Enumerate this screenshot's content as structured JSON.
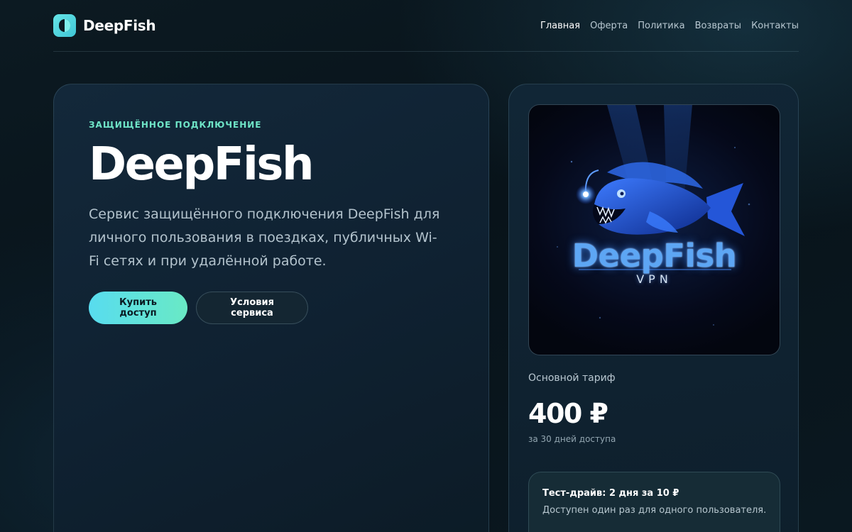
{
  "header": {
    "brand_name": "DeepFish",
    "nav": [
      {
        "label": "Главная",
        "active": true
      },
      {
        "label": "Оферта",
        "active": false
      },
      {
        "label": "Политика",
        "active": false
      },
      {
        "label": "Возвраты",
        "active": false
      },
      {
        "label": "Контакты",
        "active": false
      }
    ]
  },
  "hero": {
    "eyebrow": "Защищённое подключение",
    "title": "DeepFish",
    "description": "Сервис защищённого подключения DeepFish для личного пользования в поездках, публичных Wi-Fi сетях и при удалённой работе.",
    "buy_label": "Купить доступ",
    "terms_label": "Условия сервиса"
  },
  "product": {
    "logo_word": "DeepFish",
    "logo_sub": "VPN",
    "tariff_label": "Основной тариф",
    "price": "400 ₽",
    "price_note": "за 30 дней доступа",
    "trial_title": "Тест-драйв: 2 дня за 10 ₽",
    "trial_text": "Доступен один раз для одного пользователя."
  },
  "colors": {
    "accent_start": "#58dcef",
    "accent_end": "#69e9c5",
    "eyebrow": "#6fe6c8",
    "background": "#08131a"
  }
}
